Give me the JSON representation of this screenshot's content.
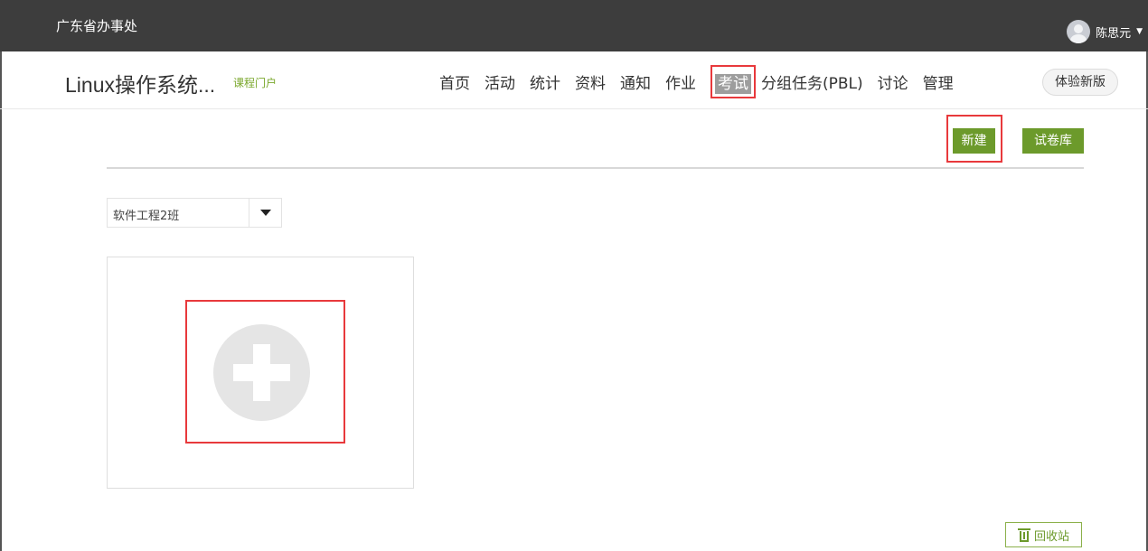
{
  "topbar": {
    "org_name": "广东省办事处",
    "user_name": "陈思元"
  },
  "course": {
    "title": "Linux操作系统...",
    "portal_link": "课程门户"
  },
  "nav": {
    "items": [
      "首页",
      "活动",
      "统计",
      "资料",
      "通知",
      "作业",
      "考试",
      "分组任务(PBL)",
      "讨论",
      "管理"
    ],
    "active": "考试",
    "try_new": "体验新版"
  },
  "actions": {
    "new_label": "新建",
    "paper_bank_label": "试卷库"
  },
  "class_select": {
    "selected": "软件工程2班"
  },
  "recycle": {
    "label": "回收站"
  },
  "colors": {
    "accent_green": "#6c9a2b",
    "highlight_red": "#e8393c",
    "topbar_bg": "#3d3d3d"
  }
}
